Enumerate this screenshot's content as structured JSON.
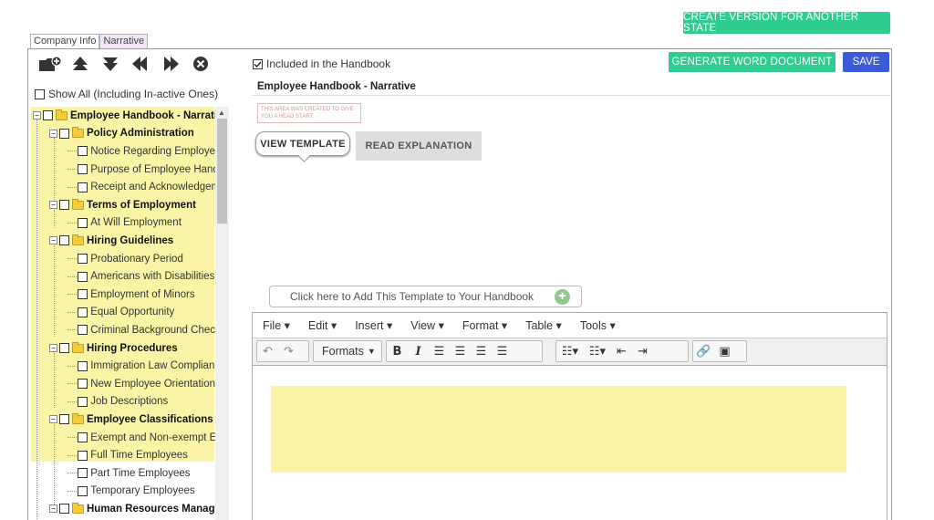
{
  "top": {
    "create_version_label": "CREATE VERSION FOR ANOTHER STATE"
  },
  "tabs": [
    {
      "label": "Company Info"
    },
    {
      "label": "Narrative"
    }
  ],
  "left": {
    "icons": [
      "add-folder-icon",
      "move-up-icon",
      "move-down-icon",
      "move-left-icon",
      "move-right-icon",
      "delete-icon"
    ],
    "show_all_label": "Show All (Including In-active Ones)",
    "tree": [
      {
        "label": "Employee Handbook - Narrative",
        "type": "folder"
      },
      {
        "label": "Policy Administration",
        "type": "folder"
      },
      {
        "label": "Notice Regarding Employee Handbook",
        "type": "item"
      },
      {
        "label": "Purpose of Employee Handbook",
        "type": "item"
      },
      {
        "label": "Receipt and Acknowledgement",
        "type": "item"
      },
      {
        "label": "Terms of Employment",
        "type": "folder"
      },
      {
        "label": "At Will Employment",
        "type": "item"
      },
      {
        "label": "Hiring Guidelines",
        "type": "folder"
      },
      {
        "label": "Probationary Period",
        "type": "item"
      },
      {
        "label": "Americans with Disabilities Act",
        "type": "item"
      },
      {
        "label": "Employment of Minors",
        "type": "item"
      },
      {
        "label": "Equal Opportunity",
        "type": "item"
      },
      {
        "label": "Criminal Background Checks",
        "type": "item"
      },
      {
        "label": "Hiring Procedures",
        "type": "folder"
      },
      {
        "label": "Immigration Law Compliance",
        "type": "item"
      },
      {
        "label": "New Employee Orientation",
        "type": "item"
      },
      {
        "label": "Job Descriptions",
        "type": "item"
      },
      {
        "label": "Employee Classifications",
        "type": "folder"
      },
      {
        "label": "Exempt and Non-exempt Employees",
        "type": "item"
      },
      {
        "label": "Full Time Employees",
        "type": "item"
      },
      {
        "label": "Part Time Employees",
        "type": "item"
      },
      {
        "label": "Temporary Employees",
        "type": "item"
      },
      {
        "label": "Human Resources Management",
        "type": "folder"
      }
    ]
  },
  "main": {
    "included_label": "Included in the Handbook",
    "generate_label": "GENERATE WORD DOCUMENT",
    "save_label": "SAVE",
    "title_value": "Employee Handbook - Narrative",
    "stamp_text": "THIS AREA WAS CREATED TO GIVE YOU A HEAD START.",
    "view_template_label": "VIEW TEMPLATE",
    "read_explanation_label": "READ EXPLANATION",
    "add_template_label": "Click here to Add This Template to Your Handbook"
  },
  "editor": {
    "menus": [
      "File",
      "Edit",
      "Insert",
      "View",
      "Format",
      "Table",
      "Tools"
    ],
    "formats_label": "Formats"
  },
  "colors": {
    "green": "#2ecc8f",
    "blue": "#3b5bd8",
    "highlight": "#faf5a6"
  }
}
